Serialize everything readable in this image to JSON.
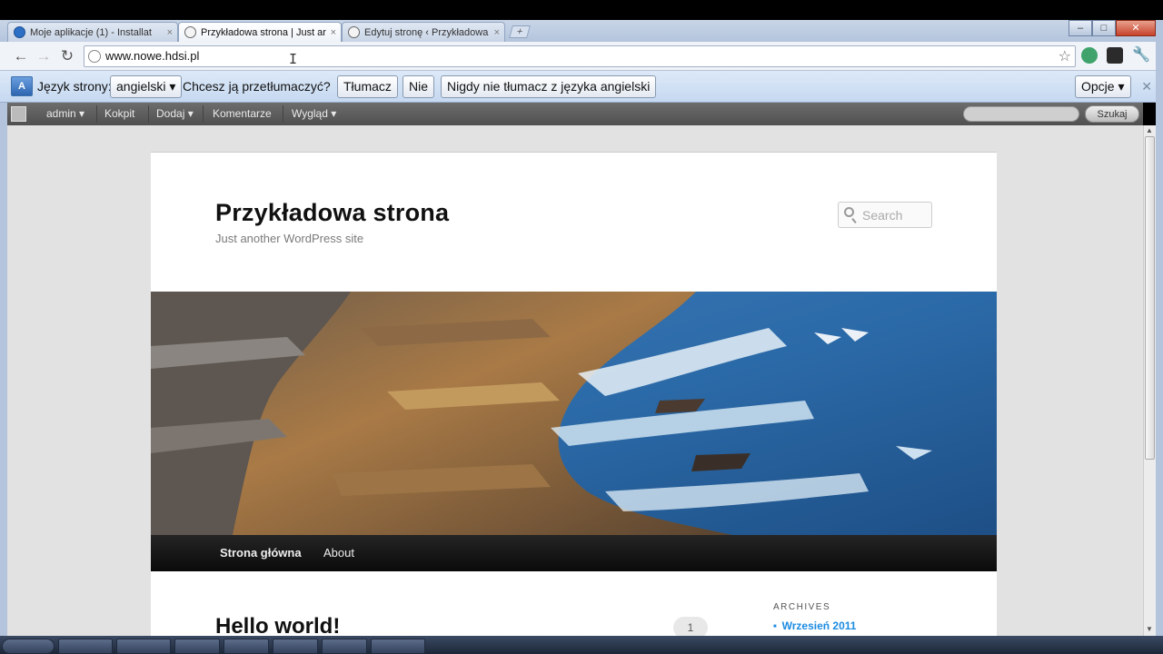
{
  "browser": {
    "tabs": [
      {
        "title": "Moje aplikacje (1) - Installat",
        "active": false
      },
      {
        "title": "Przykładowa strona | Just ar",
        "active": true
      },
      {
        "title": "Edytuj stronę ‹ Przykładowa",
        "active": false
      }
    ],
    "tab_close": "×",
    "new_tab": "+",
    "window_buttons": {
      "minimize": "–",
      "maximize": "□",
      "close": "✕"
    },
    "url": "www.nowe.hdsi.pl",
    "nav": {
      "back": "←",
      "forward": "→",
      "reload": "↻"
    },
    "star": "☆"
  },
  "translate_bar": {
    "icon_text": "A",
    "language_label": "Język strony:",
    "language_value": "angielski ▾",
    "question": "Chcesz ją przetłumaczyć?",
    "translate_button": "Tłumacz",
    "no_button": "Nie",
    "never_button": "Nigdy nie tłumacz z języka angielski",
    "options_button": "Opcje ▾",
    "close": "✕"
  },
  "admin_bar": {
    "items": [
      "admin ▾",
      "Kokpit",
      "Dodaj ▾",
      "Komentarze",
      "Wygląd ▾"
    ],
    "search_button": "Szukaj"
  },
  "site": {
    "title": "Przykładowa strona",
    "description": "Just another WordPress site",
    "search_placeholder": "Search",
    "menu": [
      "Strona główna",
      "About"
    ],
    "post_title": "Hello world!",
    "comment_count": "1",
    "sidebar": {
      "widget_title": "ARCHIVES",
      "archive_link": "Wrzesień 2011"
    }
  },
  "colors": {
    "link": "#1b8be0",
    "menu_bg": "#111111",
    "infobar_bg": "#c6d9f1"
  }
}
